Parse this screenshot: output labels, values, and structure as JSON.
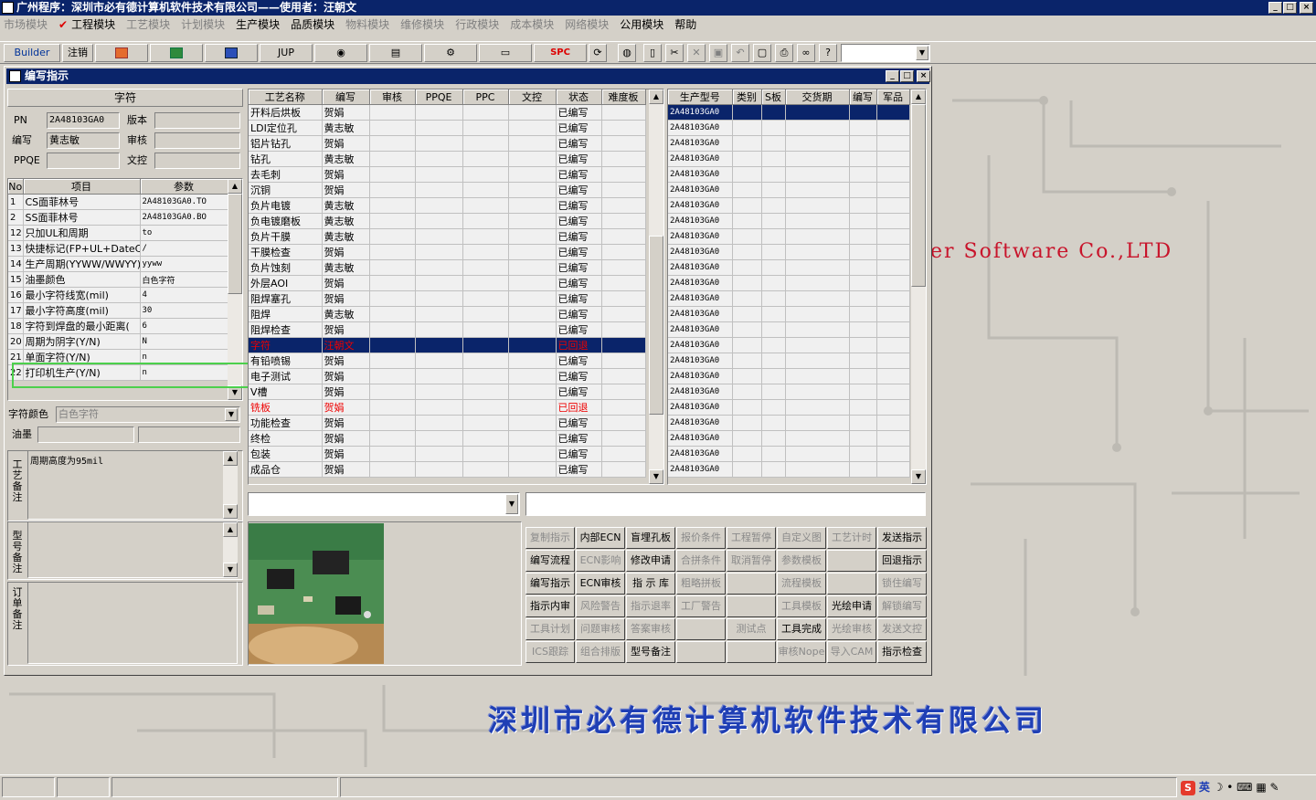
{
  "window": {
    "title": "广州程序：深圳市必有德计算机软件技术有限公司——使用者：汪朝文"
  },
  "menu": [
    {
      "label": "市场模块",
      "enabled": false
    },
    {
      "label": "工程模块",
      "enabled": true,
      "checked": true
    },
    {
      "label": "工艺模块",
      "enabled": false
    },
    {
      "label": "计划模块",
      "enabled": false
    },
    {
      "label": "生产模块",
      "enabled": true
    },
    {
      "label": "品质模块",
      "enabled": true
    },
    {
      "label": "物料模块",
      "enabled": false
    },
    {
      "label": "维修模块",
      "enabled": false
    },
    {
      "label": "行政模块",
      "enabled": false
    },
    {
      "label": "成本模块",
      "enabled": false
    },
    {
      "label": "网络模块",
      "enabled": false
    },
    {
      "label": "公用模块",
      "enabled": true
    },
    {
      "label": "帮助",
      "enabled": true
    }
  ],
  "toolbar": {
    "builder": "Builder",
    "logout": "注销",
    "jup": "JUP",
    "spc": "SPC"
  },
  "desktop": {
    "company_en": "er Software Co.,LTD",
    "company_cn": "深圳市必有德计算机软件技术有限公司"
  },
  "child": {
    "title": "编写指示"
  },
  "info": {
    "header": "字符",
    "pn_label": "PN",
    "pn_value": "2A48103GA0",
    "version_label": "版本",
    "version_value": "",
    "writer_label": "编写",
    "writer_value": "黄志敏",
    "review_label": "审核",
    "review_value": "",
    "ppqe_label": "PPQE",
    "ppqe_value": "",
    "doc_label": "文控",
    "doc_value": ""
  },
  "params": {
    "headers": [
      "No",
      "项目",
      "参数"
    ],
    "rows": [
      [
        "1",
        "CS面菲林号",
        "2A48103GA0.TO"
      ],
      [
        "2",
        "SS面菲林号",
        "2A48103GA0.BO"
      ],
      [
        "12",
        "只加UL和周期",
        "to"
      ],
      [
        "13",
        "快捷标记(FP+UL+DateCo",
        "/"
      ],
      [
        "14",
        "生产周期(YYWW/WWYY)",
        "yyww"
      ],
      [
        "15",
        "油墨颜色",
        "白色字符"
      ],
      [
        "16",
        "最小字符线宽(mil)",
        "4"
      ],
      [
        "17",
        "最小字符高度(mil)",
        "30"
      ],
      [
        "18",
        "字符到焊盘的最小距离(",
        "6"
      ],
      [
        "20",
        "周期为阴字(Y/N)",
        "N"
      ],
      [
        "21",
        "单面字符(Y/N)",
        "n"
      ],
      [
        "22",
        "打印机生产(Y/N)",
        "n"
      ]
    ]
  },
  "char_color": {
    "label": "字符颜色",
    "value": "白色字符"
  },
  "ink": {
    "label": "油墨",
    "value": ""
  },
  "process_note": {
    "label": "工艺备注",
    "value": "周期高度为95mil"
  },
  "model_note": {
    "label": "型号备注",
    "value": ""
  },
  "order_note": {
    "label": "订单备注",
    "value": ""
  },
  "process": {
    "headers": [
      "工艺名称",
      "编写",
      "审核",
      "PPQE",
      "PPC",
      "文控",
      "状态",
      "难度板"
    ],
    "rows": [
      {
        "name": "开料后烘板",
        "writer": "贺娟",
        "status": "已编写"
      },
      {
        "name": "LDI定位孔",
        "writer": "黄志敏",
        "status": "已编写"
      },
      {
        "name": "铝片钻孔",
        "writer": "贺娟",
        "status": "已编写"
      },
      {
        "name": "钻孔",
        "writer": "黄志敏",
        "status": "已编写"
      },
      {
        "name": "去毛刺",
        "writer": "贺娟",
        "status": "已编写"
      },
      {
        "name": "沉铜",
        "writer": "贺娟",
        "status": "已编写"
      },
      {
        "name": "负片电镀",
        "writer": "黄志敏",
        "status": "已编写"
      },
      {
        "name": "负电镀磨板",
        "writer": "黄志敏",
        "status": "已编写"
      },
      {
        "name": "负片干膜",
        "writer": "黄志敏",
        "status": "已编写"
      },
      {
        "name": "干膜检查",
        "writer": "贺娟",
        "status": "已编写"
      },
      {
        "name": "负片蚀刻",
        "writer": "黄志敏",
        "status": "已编写"
      },
      {
        "name": "外层AOI",
        "writer": "贺娟",
        "status": "已编写"
      },
      {
        "name": "阻焊塞孔",
        "writer": "贺娟",
        "status": "已编写"
      },
      {
        "name": "阻焊",
        "writer": "黄志敏",
        "status": "已编写"
      },
      {
        "name": "阻焊检查",
        "writer": "贺娟",
        "status": "已编写"
      },
      {
        "name": "字符",
        "writer": "汪朝文",
        "status": "已回退",
        "selected": true
      },
      {
        "name": "有铅喷锡",
        "writer": "贺娟",
        "status": "已编写"
      },
      {
        "name": "电子测试",
        "writer": "贺娟",
        "status": "已编写"
      },
      {
        "name": "V槽",
        "writer": "贺娟",
        "status": "已编写"
      },
      {
        "name": "铣板",
        "writer": "贺娟",
        "status": "已回退",
        "red": true
      },
      {
        "name": "功能检查",
        "writer": "贺娟",
        "status": "已编写"
      },
      {
        "name": "终检",
        "writer": "贺娟",
        "status": "已编写"
      },
      {
        "name": "包装",
        "writer": "贺娟",
        "status": "已编写"
      },
      {
        "name": "成品仓",
        "writer": "贺娟",
        "status": "已编写"
      }
    ]
  },
  "models": {
    "headers": [
      "生产型号",
      "类别",
      "S板",
      "交货期",
      "编写",
      "军品"
    ],
    "rows": [
      "2A48103GA0",
      "2A48103GA0",
      "2A48103GA0",
      "2A48103GA0",
      "2A48103GA0",
      "2A48103GA0",
      "2A48103GA0",
      "2A48103GA0",
      "2A48103GA0",
      "2A48103GA0",
      "2A48103GA0",
      "2A48103GA0",
      "2A48103GA0",
      "2A48103GA0",
      "2A48103GA0",
      "2A48103GA0",
      "2A48103GA0",
      "2A48103GA0",
      "2A48103GA0",
      "2A48103GA0",
      "2A48103GA0",
      "2A48103GA0",
      "2A48103GA0",
      "2A48103GA0"
    ]
  },
  "buttons": [
    [
      {
        "label": "复制指示",
        "enabled": false
      },
      {
        "label": "内部ECN",
        "enabled": true
      },
      {
        "label": "盲埋孔板",
        "enabled": true
      },
      {
        "label": "报价条件",
        "enabled": false
      },
      {
        "label": "工程暂停",
        "enabled": false
      },
      {
        "label": "自定义图",
        "enabled": false
      },
      {
        "label": "工艺计时",
        "enabled": false
      },
      {
        "label": "发送指示",
        "enabled": true
      }
    ],
    [
      {
        "label": "编写流程",
        "enabled": true
      },
      {
        "label": "ECN影响",
        "enabled": false
      },
      {
        "label": "修改申请",
        "enabled": true
      },
      {
        "label": "合拼条件",
        "enabled": false
      },
      {
        "label": "取消暂停",
        "enabled": false
      },
      {
        "label": "参数模板",
        "enabled": false
      },
      {
        "label": "",
        "enabled": false
      },
      {
        "label": "回退指示",
        "enabled": true
      }
    ],
    [
      {
        "label": "编写指示",
        "enabled": true
      },
      {
        "label": "ECN审核",
        "enabled": true
      },
      {
        "label": "指 示 库",
        "enabled": true
      },
      {
        "label": "粗略拼板",
        "enabled": false
      },
      {
        "label": "",
        "enabled": false
      },
      {
        "label": "流程模板",
        "enabled": false
      },
      {
        "label": "",
        "enabled": false
      },
      {
        "label": "锁住编写",
        "enabled": false
      }
    ],
    [
      {
        "label": "指示内审",
        "enabled": true
      },
      {
        "label": "风险警告",
        "enabled": false
      },
      {
        "label": "指示退率",
        "enabled": false
      },
      {
        "label": "工厂警告",
        "enabled": false
      },
      {
        "label": "",
        "enabled": false
      },
      {
        "label": "工具模板",
        "enabled": false
      },
      {
        "label": "光绘申请",
        "enabled": true
      },
      {
        "label": "解锁编写",
        "enabled": false
      }
    ],
    [
      {
        "label": "工具计划",
        "enabled": false
      },
      {
        "label": "问题审核",
        "enabled": false
      },
      {
        "label": "答案审核",
        "enabled": false
      },
      {
        "label": "",
        "enabled": false
      },
      {
        "label": "测试点",
        "enabled": false
      },
      {
        "label": "工具完成",
        "enabled": true
      },
      {
        "label": "光绘审核",
        "enabled": false
      },
      {
        "label": "发送文控",
        "enabled": false
      }
    ],
    [
      {
        "label": "ICS跟踪",
        "enabled": false
      },
      {
        "label": "组合排版",
        "enabled": false
      },
      {
        "label": "型号备注",
        "enabled": true
      },
      {
        "label": "",
        "enabled": false
      },
      {
        "label": "",
        "enabled": false
      },
      {
        "label": "审核Nope",
        "enabled": false
      },
      {
        "label": "导入CAM",
        "enabled": false
      },
      {
        "label": "指示检查",
        "enabled": true
      }
    ]
  ],
  "tray": {
    "ime": "英"
  }
}
